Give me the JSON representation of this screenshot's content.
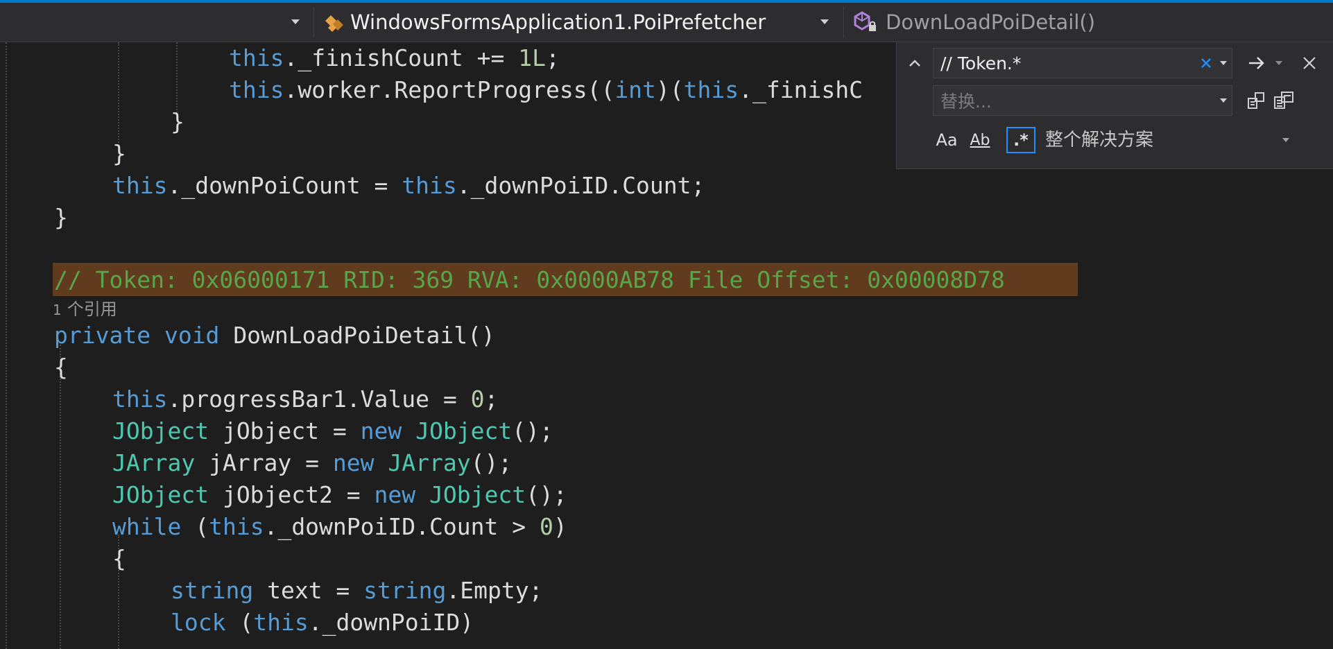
{
  "navbar": {
    "class_dropdown": "WindowsFormsApplication1.PoiPrefetcher",
    "member_dropdown": "DownLoadPoiDetail()"
  },
  "code": {
    "line1": {
      "a": "this",
      "b": "._finishCount += ",
      "c": "1L",
      "d": ";"
    },
    "line2": {
      "a": "this",
      "b": ".worker.ReportProgress((",
      "c": "int",
      "d": ")(",
      "e": "this",
      "f": "._finishC"
    },
    "line3": "}",
    "line4": "}",
    "line5": {
      "a": "this",
      "b": "._downPoiCount = ",
      "c": "this",
      "d": "._downPoiID.Count;"
    },
    "line6": "}",
    "comment": "// Token: 0x06000171 RID: 369 RVA: 0x0000AB78 File Offset: 0x00008D78",
    "refs": {
      "count": "1",
      "label": "个引用"
    },
    "signature": {
      "kw1": "private",
      "kw2": "void",
      "name": "DownLoadPoiDetail()"
    },
    "open1": "{",
    "l_progress": {
      "a": "this",
      "b": ".progressBar1.Value = ",
      "c": "0",
      "d": ";"
    },
    "l_jobj": {
      "t1": "JObject",
      "v": " jObject = ",
      "kw": "new",
      "t2": "JObject",
      "e": "();"
    },
    "l_jarr": {
      "t1": "JArray",
      "v": " jArray = ",
      "kw": "new",
      "t2": "JArray",
      "e": "();"
    },
    "l_jobj2": {
      "t1": "JObject",
      "v": " jObject2 = ",
      "kw": "new",
      "t2": "JObject",
      "e": "();"
    },
    "l_while": {
      "kw": "while",
      "a": " (",
      "th": "this",
      "b": "._downPoiID.Count > ",
      "n": "0",
      "c": ")"
    },
    "open2": "{",
    "l_string": {
      "t1": "string",
      "v": " text = ",
      "t2": "string",
      "e": ".Empty;"
    },
    "l_lock": {
      "kw": "lock",
      "a": " (",
      "th": "this",
      "b": "._downPoiID)"
    }
  },
  "find_panel": {
    "find_value": "// Token.*",
    "replace_placeholder": "替换...",
    "match_case_label": "Aa",
    "whole_word_label": "Ab",
    "regex_label": ".*",
    "scope": "整个解决方案"
  },
  "icons": [
    "class-icon",
    "method-icon",
    "collapse-icon",
    "clear-icon",
    "find-next-icon",
    "close-icon",
    "replace-next-icon",
    "replace-all-icon"
  ],
  "colors": {
    "accent": "#007acc",
    "keyword": "#569cd6",
    "type": "#4ec9b0",
    "number": "#b5cea8",
    "comment": "#57a64a",
    "highlight": "#613b1d"
  }
}
